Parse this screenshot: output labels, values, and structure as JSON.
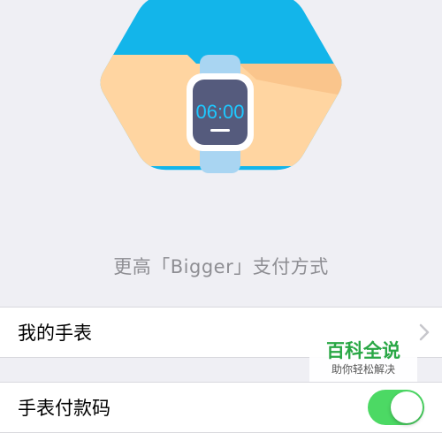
{
  "hero": {
    "watch_time": "06:00",
    "tagline": "更高「Bigger」支付方式",
    "colors": {
      "hex_blue": "#13b5ea",
      "arm": "#ffd5a1",
      "arm_shadow": "#f5b87c",
      "strap": "#a9d5f2",
      "bezel": "#ffffff",
      "face": "#555b7d",
      "time_text": "#1ec8ff"
    }
  },
  "settings": {
    "my_watch_label": "我的手表",
    "payment_code_label": "手表付款码",
    "payment_code_enabled": true
  },
  "watermark": {
    "main": "百科全说",
    "sub": "助你轻松解决"
  }
}
